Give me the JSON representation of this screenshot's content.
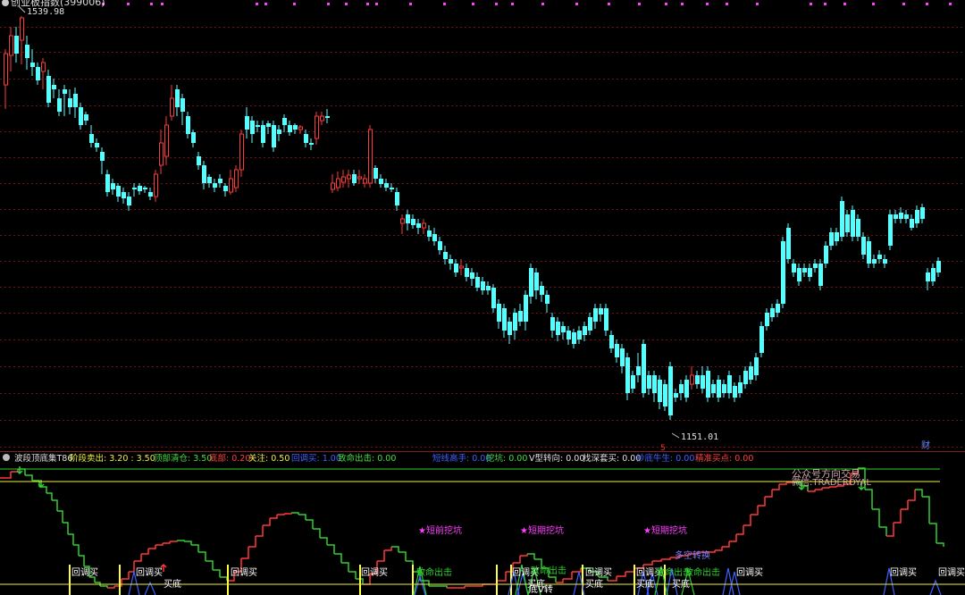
{
  "header": {
    "instrument_title": "创业板指数(399006)",
    "high_price_label": "1539.98",
    "low_price_label": "1151.01",
    "marker_5": "5",
    "finance_tab": "财"
  },
  "indicator": {
    "name": "波段顶底集T86",
    "params": [
      {
        "label": "阶段卖出:",
        "value": "3.20 : 3.50",
        "color": "#f0f040"
      },
      {
        "label": "顶部清仓:",
        "value": "3.50",
        "color": "#40e040"
      },
      {
        "label": "底部:",
        "value": "0.20",
        "color": "#ff4040"
      },
      {
        "label": "关注:",
        "value": "0.50",
        "color": "#f0f040"
      },
      {
        "label": "回调买:",
        "value": "1.00",
        "color": "#4060ff"
      },
      {
        "label": "致命出击:",
        "value": "0.00",
        "color": "#40e040"
      },
      {
        "label": "短线高手:",
        "value": "0.00",
        "color": "#4060ff"
      },
      {
        "label": "挖坑:",
        "value": "0.00",
        "color": "#40e040"
      },
      {
        "label": "V型转向:",
        "value": "0.00",
        "color": "#e0e0e0"
      },
      {
        "label": "找深套买:",
        "value": "0.00",
        "color": "#e0e0e0"
      },
      {
        "label": "抄底牛生:",
        "value": "0.00",
        "color": "#4060ff"
      },
      {
        "label": "精准买点:",
        "value": "0.00",
        "color": "#ff4040"
      }
    ]
  },
  "signals": {
    "pit_labels": [
      "★短前挖坑",
      "★短期挖坑",
      "★短期挖坑"
    ],
    "watermark_cn": "公众号方向交易",
    "watermark_en": "微信:TRADEROYAL",
    "buy_pullback": "回调买",
    "strike": "致命出击",
    "bottom_buy": "买底",
    "v_turn": "底V转",
    "long_short": "多空转换"
  },
  "colors": {
    "up": "#ff3838",
    "down": "#54ffff",
    "grid": "#7a1010",
    "yellow": "#ffff40",
    "green": "#30d030",
    "magenta": "#ff40ff",
    "blue": "#4060ff"
  }
}
